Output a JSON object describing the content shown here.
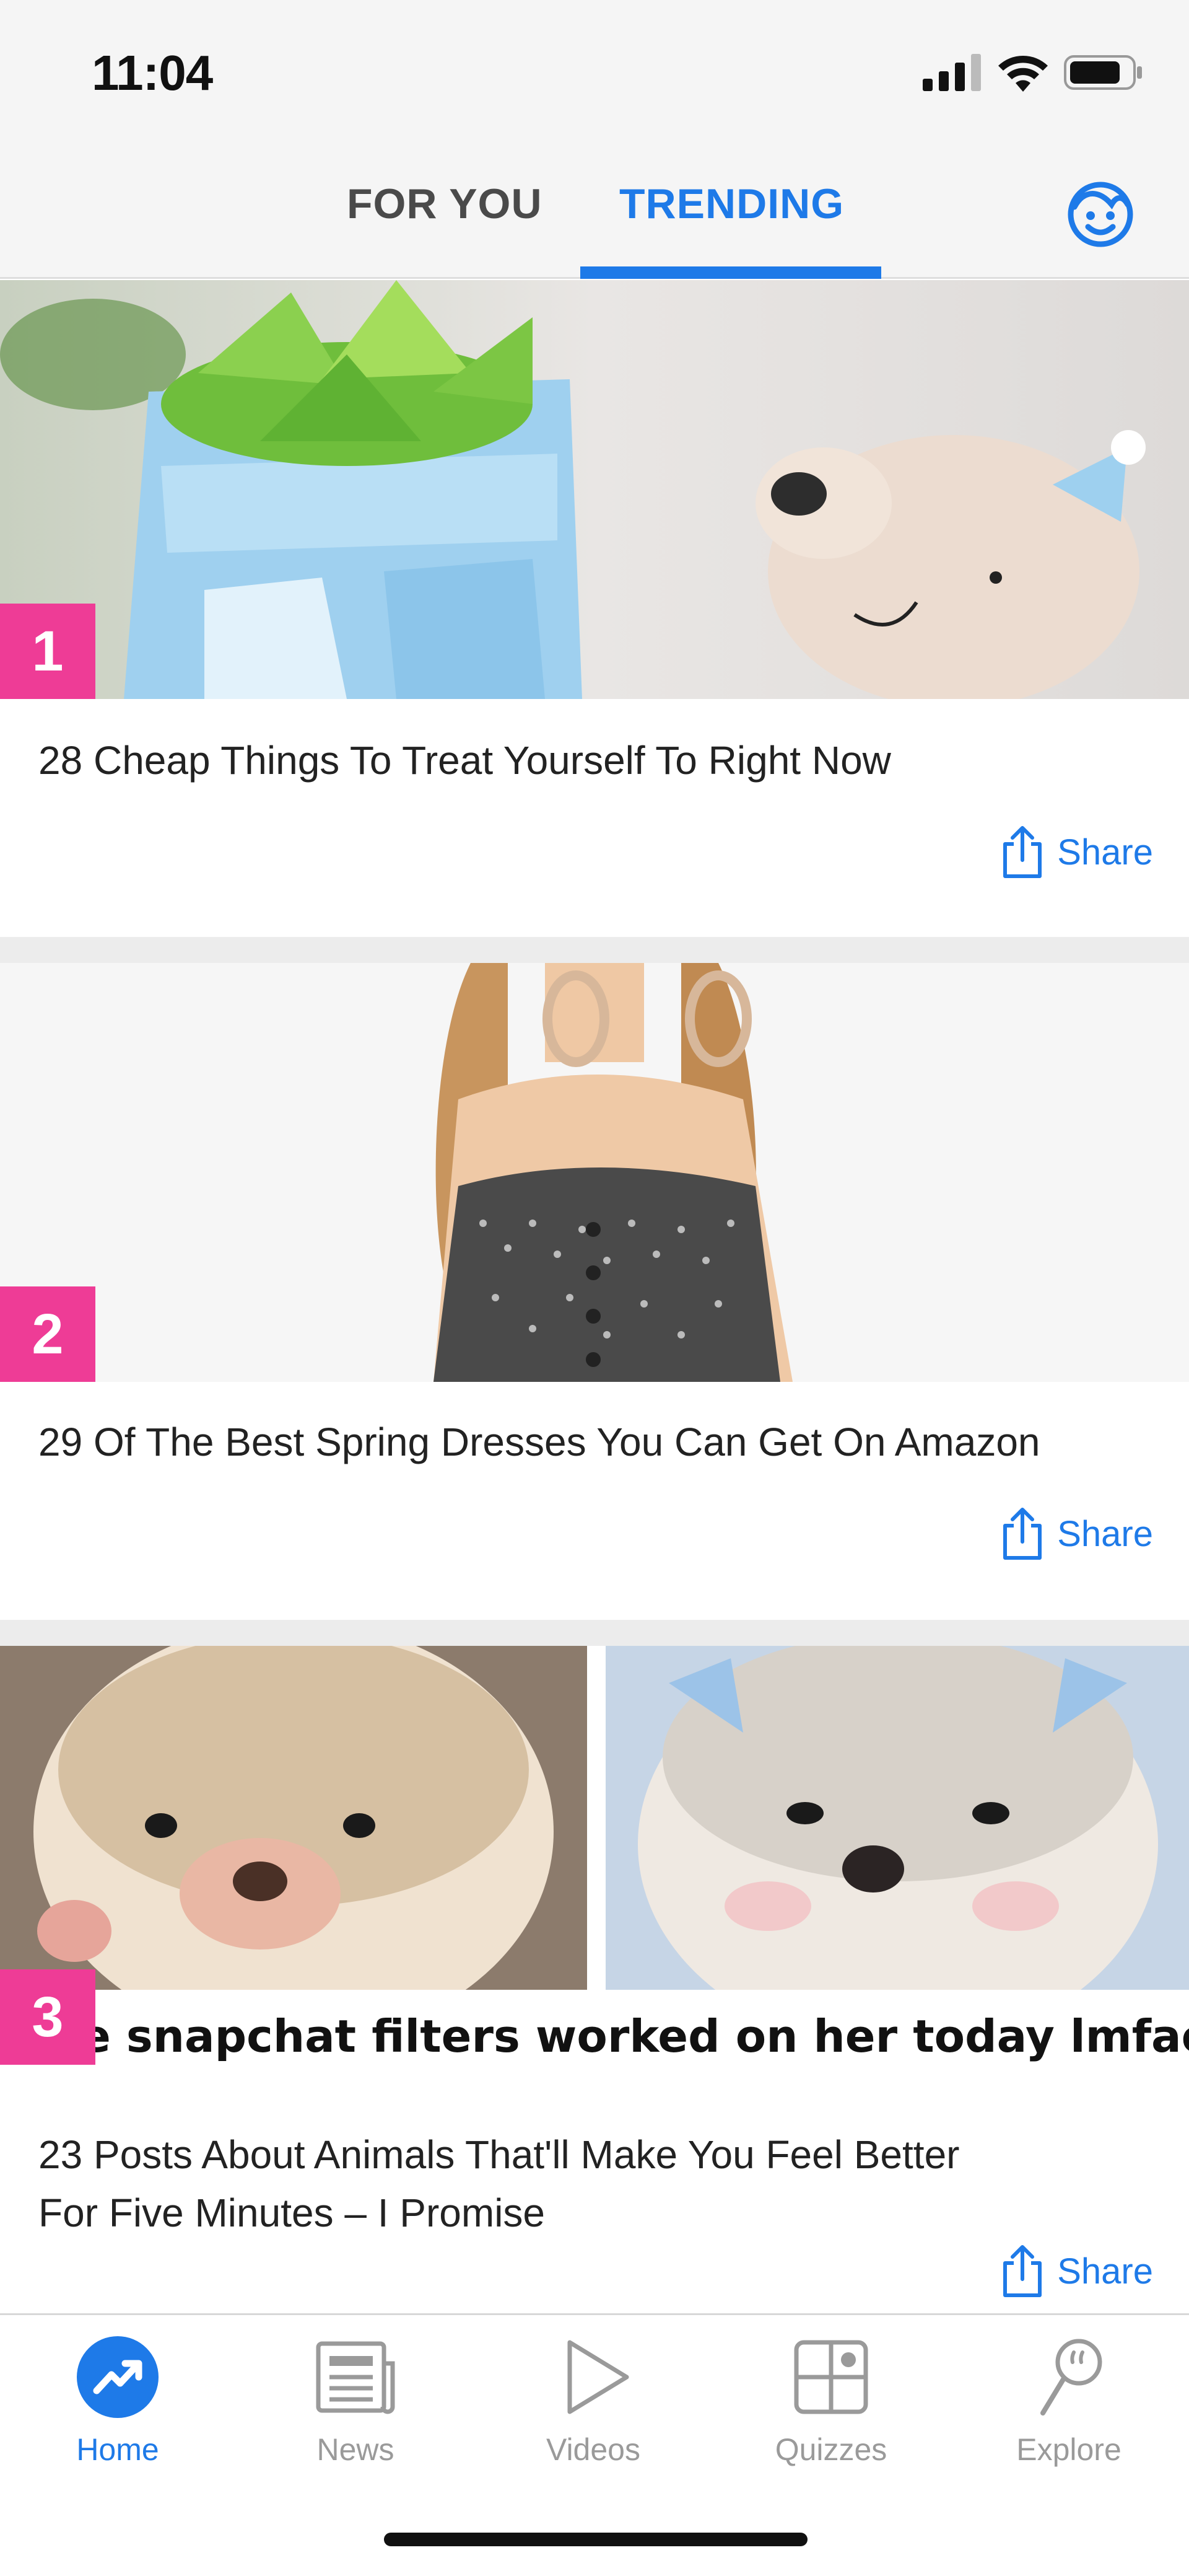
{
  "status_bar": {
    "time": "11:04",
    "icons": [
      "cellular-signal-icon",
      "wifi-icon",
      "battery-icon"
    ]
  },
  "header": {
    "tabs": [
      {
        "label": "FOR YOU",
        "active": false
      },
      {
        "label": "TRENDING",
        "active": true
      }
    ],
    "profile_icon": "smiley-face-icon"
  },
  "posts": [
    {
      "rank": "1",
      "title": "28 Cheap Things To Treat Yourself To Right Now",
      "share_label": "Share",
      "image_description_icon": "succulent-and-bear-figurine-image"
    },
    {
      "rank": "2",
      "title": "29 Of The Best Spring Dresses You Can Get On Amazon",
      "share_label": "Share",
      "image_description_icon": "woman-in-dress-image"
    },
    {
      "rank": "3",
      "title": "23 Posts About Animals That'll Make You Feel Better\nFor Five Minutes – I Promise",
      "share_label": "Share",
      "image_caption": "e snapchat filters worked on her today lmfao",
      "image_description_icon": "hedgehogs-image"
    }
  ],
  "bottom_nav": {
    "items": [
      {
        "label": "Home",
        "icon": "trending-arrow-icon",
        "active": true
      },
      {
        "label": "News",
        "icon": "newspaper-icon",
        "active": false
      },
      {
        "label": "Videos",
        "icon": "play-icon",
        "active": false
      },
      {
        "label": "Quizzes",
        "icon": "quiz-grid-icon",
        "active": false
      },
      {
        "label": "Explore",
        "icon": "magnifier-icon",
        "active": false
      }
    ]
  },
  "colors": {
    "accent": "#1e7ae8",
    "rank_badge": "#ee3c96",
    "inactive_nav": "#9a9a9a"
  }
}
